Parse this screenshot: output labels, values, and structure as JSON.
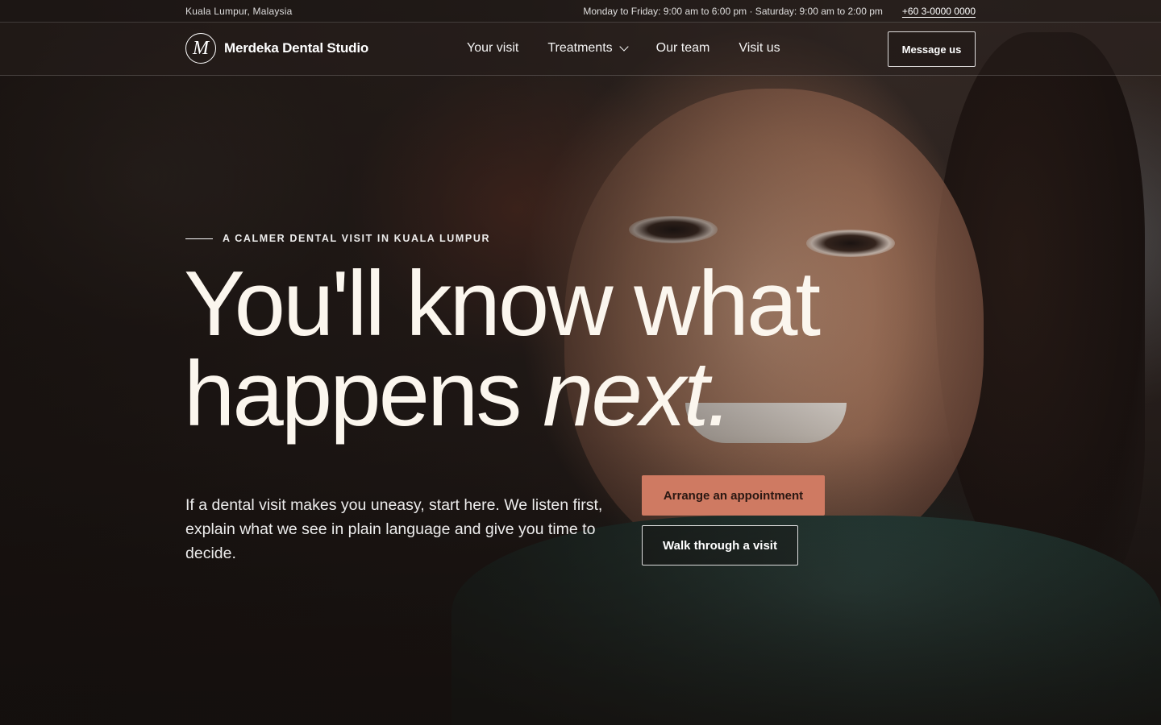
{
  "topbar": {
    "location": "Kuala Lumpur, Malaysia",
    "hours": "Monday to Friday: 9:00 am to 6:00 pm · Saturday: 9:00 am to 2:00 pm",
    "phone": "+60 3-0000 0000"
  },
  "header": {
    "logo_mark": "M",
    "brand_name": "Merdeka Dental Studio",
    "nav": [
      {
        "label": "Your visit"
      },
      {
        "label": "Treatments",
        "has_dropdown": true,
        "icon": "chevron-down-icon"
      },
      {
        "label": "Our team"
      },
      {
        "label": "Visit us"
      }
    ],
    "message_button": "Message us"
  },
  "hero": {
    "eyebrow": "A CALMER DENTAL VISIT IN KUALA LUMPUR",
    "headline_line1": "You'll know what",
    "headline_line2": "happens ",
    "headline_emphasis": "next.",
    "lede": "If a dental visit makes you uneasy, start here. We listen first, explain what we see in plain language and give you time to decide.",
    "primary_cta": "Arrange an appointment",
    "secondary_cta": "Walk through a visit"
  },
  "colors": {
    "accent": "#cf7a62",
    "headline": "#fbf6ee",
    "background": "#1c1614"
  }
}
